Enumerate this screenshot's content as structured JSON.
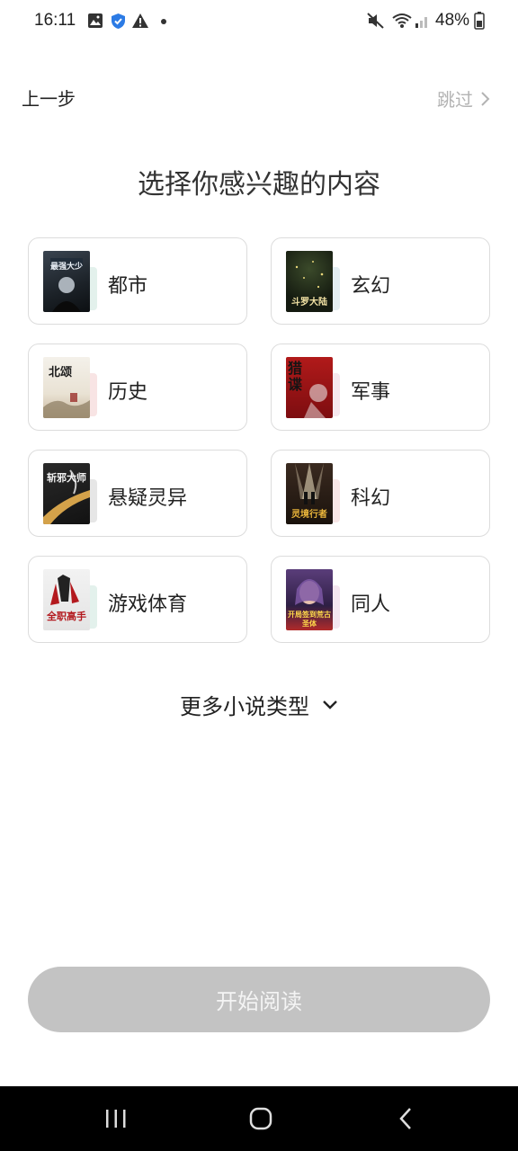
{
  "status_bar": {
    "time": "16:11",
    "battery": "48%",
    "icons": [
      "image-icon",
      "shield-check-icon",
      "warning-icon",
      "dot-icon",
      "mute-icon",
      "wifi-icon",
      "signal-icon",
      "battery-icon"
    ]
  },
  "header": {
    "back_label": "上一步",
    "skip_label": "跳过"
  },
  "title": "选择你感兴趣的内容",
  "categories": [
    {
      "label": "都市",
      "cover_text": "最强大少",
      "tab_color": "#e3f1ec"
    },
    {
      "label": "玄幻",
      "cover_text": "斗罗大陆",
      "tab_color": "#e3eef3"
    },
    {
      "label": "历史",
      "cover_text": "北颂",
      "tab_color": "#f8e4e4"
    },
    {
      "label": "军事",
      "cover_text": "猎谍",
      "tab_color": "#f6e7ee"
    },
    {
      "label": "悬疑灵异",
      "cover_text": "斩邪大师",
      "tab_color": "#e6e6e6"
    },
    {
      "label": "科幻",
      "cover_text": "灵境行者",
      "tab_color": "#f8e6e6"
    },
    {
      "label": "游戏体育",
      "cover_text": "全职高手",
      "tab_color": "#e3f1ec"
    },
    {
      "label": "同人",
      "cover_text": "开局签到荒古圣体",
      "tab_color": "#f4e6f0"
    }
  ],
  "more_types_label": "更多小说类型",
  "start_button_label": "开始阅读",
  "colors": {
    "button_disabled": "#c3c3c3",
    "skip_text": "#b3b3b3"
  }
}
